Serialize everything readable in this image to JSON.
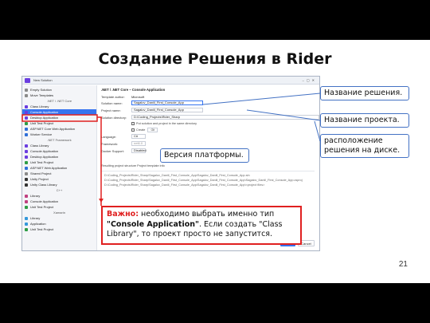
{
  "slide": {
    "title": "Создание Решения в Rider",
    "page_number": "21"
  },
  "window": {
    "title": "New Solution"
  },
  "templates": [
    {
      "label": "Empty Solution",
      "color": "#8a8a8a"
    },
    {
      "label": "Move Templates",
      "color": "#8a8a8a"
    },
    {
      "section": ".NET / .NET Core"
    },
    {
      "label": "Class Library",
      "color": "#6a3de0"
    },
    {
      "label": "Console Application",
      "color": "#6a3de0",
      "selected": true
    },
    {
      "label": "Desktop Application",
      "color": "#6a3de0"
    },
    {
      "label": "Unit Test Project",
      "color": "#2e9d45"
    },
    {
      "label": "ASP.NET Core Web Application",
      "color": "#2f6fd8"
    },
    {
      "label": "Worker Service",
      "color": "#2f6fd8"
    },
    {
      "section": ".NET Framework"
    },
    {
      "label": "Class Library",
      "color": "#6a3de0"
    },
    {
      "label": "Console Application",
      "color": "#6a3de0"
    },
    {
      "label": "Desktop Application",
      "color": "#6a3de0"
    },
    {
      "label": "Unit Test Project",
      "color": "#2e9d45"
    },
    {
      "label": "ASP.NET Web Application",
      "color": "#2f6fd8"
    },
    {
      "label": "Shared Project",
      "color": "#8a8a8a"
    },
    {
      "label": "Unity Project",
      "color": "#333333"
    },
    {
      "label": "Unity Class Library",
      "color": "#333333"
    },
    {
      "section": "C++"
    },
    {
      "label": "Library",
      "color": "#c04080"
    },
    {
      "label": "Console Application",
      "color": "#c04080"
    },
    {
      "label": "Unit Test Project",
      "color": "#2e9d45"
    },
    {
      "section": "Xamarin"
    },
    {
      "label": "Library",
      "color": "#3498db"
    },
    {
      "label": "Application",
      "color": "#3498db"
    },
    {
      "label": "Unit Test Project",
      "color": "#2e9d45"
    }
  ],
  "form": {
    "header": ".NET / .NET Core – Console Application",
    "template_author_label": "Template author:",
    "template_author": "Microsoft",
    "solution_name_label": "Solution name:",
    "solution_name": "Sagalov_Daniil_First_Console_App",
    "project_name_label": "Project name:",
    "project_name": "Sagalov_Daniil_First_Console_App",
    "solution_dir_label": "Solution directory:",
    "solution_dir": "D:\\Coding_Projects\\Rider_Sharp",
    "same_dir_option": "Put solution and project in the same directory",
    "create_git_option": "Create",
    "create_git_value": "Git",
    "language_label": "Language:",
    "language": "C#",
    "framework_label": "Framework:",
    "framework": "net6.0",
    "docker_label": "Docker Support:",
    "docker": "Disabled",
    "structure_tabs": "Resulting project structure   Project template info",
    "path_lines": [
      "D:\\Coding_Projects\\Rider_Sharp\\Sagalov_Daniil_First_Console_App\\Sagalov_Daniil_First_Console_App.sln",
      "D:\\Coding_Projects\\Rider_Sharp\\Sagalov_Daniil_First_Console_App\\Sagalov_Daniil_First_Console_App\\Sagalov_Daniil_First_Console_App.csproj",
      "D:\\Coding_Projects\\Rider_Sharp\\Sagalov_Daniil_First_Console_App\\Sagalov_Daniil_First_Console_App\\<project files>"
    ],
    "create_button": "Create",
    "cancel_button": "Cancel"
  },
  "callouts": {
    "solution_name": "Название решения.",
    "project_name": "Название проекта.",
    "location": "расположение решения на диске.",
    "platform": "Версия платформы."
  },
  "warning": {
    "prefix": "Важно:",
    "text1": " необходимо выбрать именно тип ",
    "q1": "\"Console Application\"",
    "text2": ". Если создать \"Class Library\", то проект просто не запустится."
  },
  "colors": {
    "accent": "#3574f0",
    "callout_border": "#4472c4",
    "warning_red": "#e02020"
  }
}
